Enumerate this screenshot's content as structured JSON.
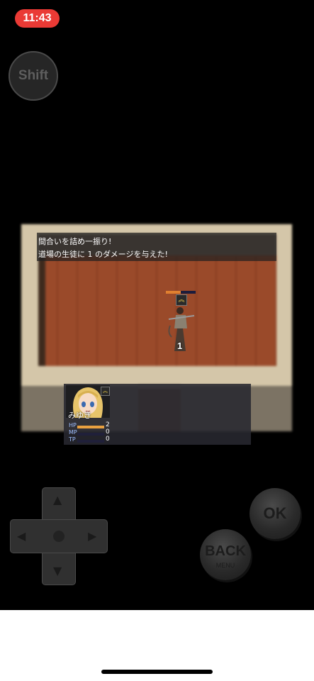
{
  "status_bar": {
    "time": "11:43"
  },
  "buttons": {
    "shift_label": "Shift",
    "ok_label": "OK",
    "back_label": "BACK",
    "back_sub_label": "MENU"
  },
  "dpad": {
    "up": "▲",
    "down": "▼",
    "left": "◀",
    "right": "▶"
  },
  "battle_log": {
    "line1": "間合いを詰め一振り!",
    "line2": "道場の生徒に 1 のダメージを与えた!"
  },
  "enemy": {
    "hp_fraction": 0.5,
    "state_icon": "double-chevron-up-icon",
    "damage_popup": "1"
  },
  "actor": {
    "name": "みゆき",
    "state_icon": "double-chevron-up-icon",
    "hp_label": "HP",
    "hp_value": "2",
    "hp_fraction": 1.0,
    "mp_label": "MP",
    "mp_value": "0",
    "mp_fraction": 0,
    "tp_label": "TP",
    "tp_value": "0",
    "tp_fraction": 0
  },
  "colors": {
    "time_pill": "#ea3a35",
    "hp_bar": "#e8a040",
    "mp_bar": "#4070d0",
    "tp_bar": "#50b050"
  }
}
